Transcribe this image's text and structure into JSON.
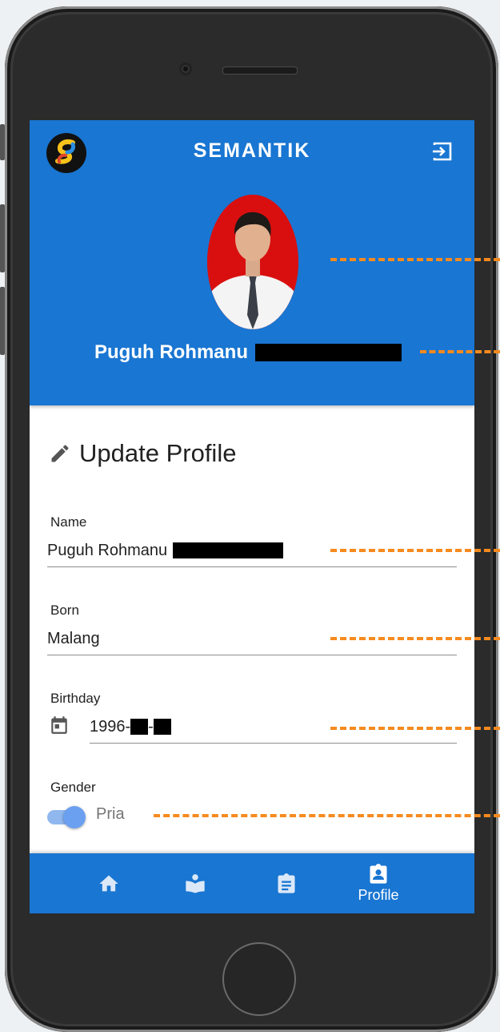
{
  "app": {
    "title": "SEMANTIK"
  },
  "profile": {
    "name": "Puguh Rohmanu"
  },
  "section": {
    "title": "Update Profile"
  },
  "form": {
    "name_label": "Name",
    "name_value": "Puguh Rohmanu",
    "born_label": "Born",
    "born_value": "Malang",
    "birthday_label": "Birthday",
    "birthday_value": "1996-",
    "birthday_sep": "-",
    "gender_label": "Gender",
    "gender_value": "Pria"
  },
  "bottom_nav": {
    "items": [
      {
        "icon": "home-icon",
        "label": ""
      },
      {
        "icon": "book-reader-icon",
        "label": ""
      },
      {
        "icon": "clipboard-icon",
        "label": ""
      },
      {
        "icon": "profile-badge-icon",
        "label": "Profile"
      }
    ]
  },
  "colors": {
    "primary": "#1976d2",
    "annotation": "#f68a1f",
    "toggle_track": "#90b8ee",
    "toggle_thumb": "#6ba0f0"
  }
}
